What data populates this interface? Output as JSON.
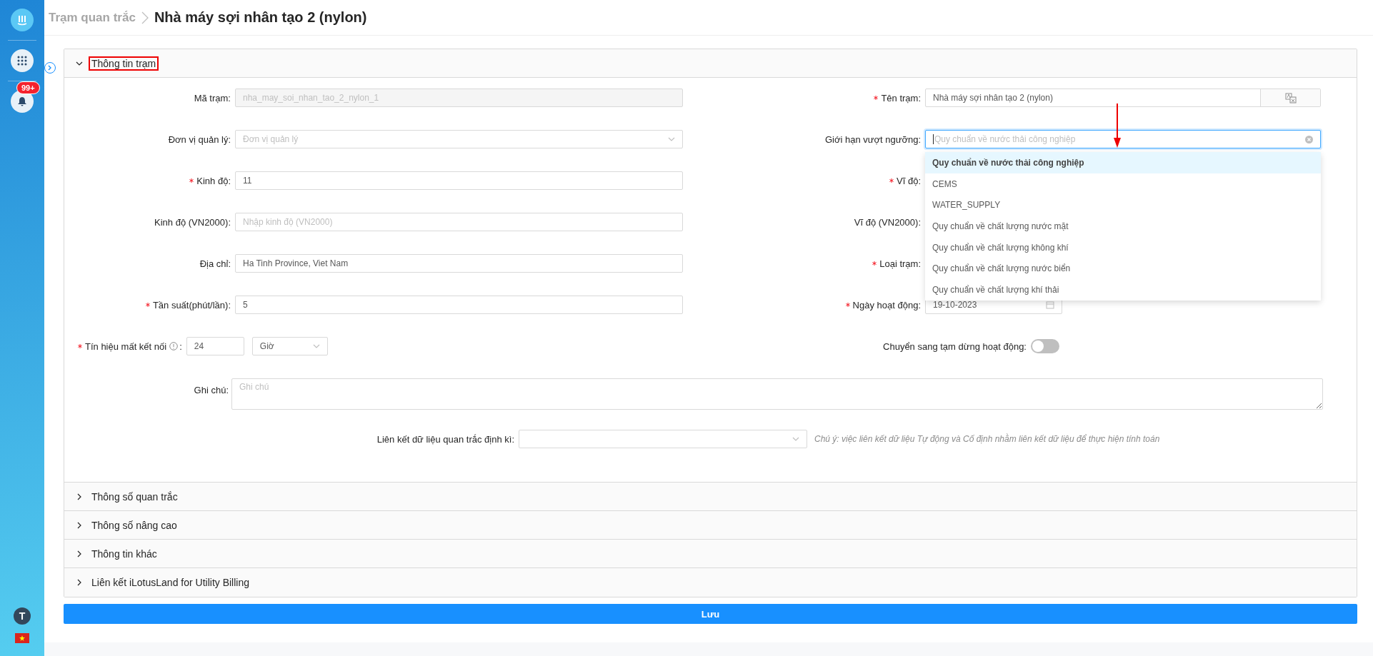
{
  "sidebar": {
    "notification_badge": "99+",
    "avatar_initial": "T"
  },
  "breadcrumb": {
    "parent": "Trạm quan trắc",
    "current": "Nhà máy sợi nhân tạo 2 (nylon)"
  },
  "sections": [
    {
      "title": "Thông tin trạm",
      "expanded": true,
      "highlighted": true
    },
    {
      "title": "Thông số quan trắc",
      "expanded": false,
      "highlighted": false
    },
    {
      "title": "Thông số nâng cao",
      "expanded": false,
      "highlighted": false
    },
    {
      "title": "Thông tin khác",
      "expanded": false,
      "highlighted": false
    },
    {
      "title": "Liên kết iLotusLand for Utility Billing",
      "expanded": false,
      "highlighted": false
    }
  ],
  "form_rows": [
    {
      "left": {
        "kind": "text",
        "label": "Mã trạm:",
        "required": false,
        "disabled": true,
        "value": "nha_may_soi_nhan_tao_2_nylon_1"
      },
      "right": {
        "kind": "text-addon",
        "label": "Tên trạm:",
        "required": true,
        "value": "Nhà máy sợi nhân tạo 2 (nylon)"
      }
    },
    {
      "left": {
        "kind": "select",
        "label": "Đơn vị quản lý:",
        "required": false,
        "placeholder": "Đơn vị quản lý"
      },
      "right": {
        "kind": "combobox",
        "label": "Giới hạn vượt ngưỡng:",
        "required": false,
        "focused": true,
        "pointed": true,
        "placeholder": "Quy chuẩn về nước thải công nghiệp",
        "options": [
          {
            "label": "Quy chuẩn về nước thải công nghiệp",
            "selected": true
          },
          {
            "label": "CEMS",
            "selected": false
          },
          {
            "label": "WATER_SUPPLY",
            "selected": false
          },
          {
            "label": "Quy chuẩn về chất lượng nước mặt",
            "selected": false
          },
          {
            "label": "Quy chuẩn về chất lượng không khí",
            "selected": false
          },
          {
            "label": "Quy chuẩn về chất lượng nước biển",
            "selected": false
          },
          {
            "label": "Quy chuẩn về chất lượng khí thải",
            "selected": false
          }
        ]
      }
    },
    {
      "left": {
        "kind": "text",
        "label": "Kinh độ:",
        "required": true,
        "value": "11"
      },
      "right": {
        "kind": "label-only",
        "label": "Vĩ độ:",
        "required": true
      }
    },
    {
      "left": {
        "kind": "text",
        "label": "Kinh độ (VN2000):",
        "required": false,
        "placeholder": "Nhập kinh độ (VN2000)"
      },
      "right": {
        "kind": "label-only",
        "label": "Vĩ độ (VN2000):",
        "required": false
      }
    },
    {
      "left": {
        "kind": "text",
        "label": "Địa chỉ:",
        "required": false,
        "value": "Ha Tinh Province, Viet Nam"
      },
      "right": {
        "kind": "label-only",
        "label": "Loại trạm:",
        "required": true
      }
    },
    {
      "left": {
        "kind": "text",
        "label": "Tần suất(phút/lần):",
        "required": true,
        "value": "5"
      },
      "right": {
        "kind": "date",
        "label": "Ngày hoạt động:",
        "required": true,
        "value": "19-10-2023"
      }
    },
    {
      "left": {
        "kind": "number-unit",
        "label": "Tín hiệu mất kết nối",
        "suffix": ":",
        "required": true,
        "value": "24",
        "unit": "Giờ"
      },
      "right": {
        "kind": "switch",
        "label": "Chuyển sang tạm dừng hoạt động:",
        "required": false,
        "on": false
      }
    }
  ],
  "note": {
    "label": "Ghi chú:",
    "placeholder": "Ghi chú"
  },
  "periodic_link": {
    "label": "Liên kết dữ liệu quan trắc định kì:",
    "hint": "Chú ý: việc liên kết dữ liệu Tự động và Cố định nhằm liên kết dữ liệu để thực hiện tính toán"
  },
  "save_button": "Lưu"
}
